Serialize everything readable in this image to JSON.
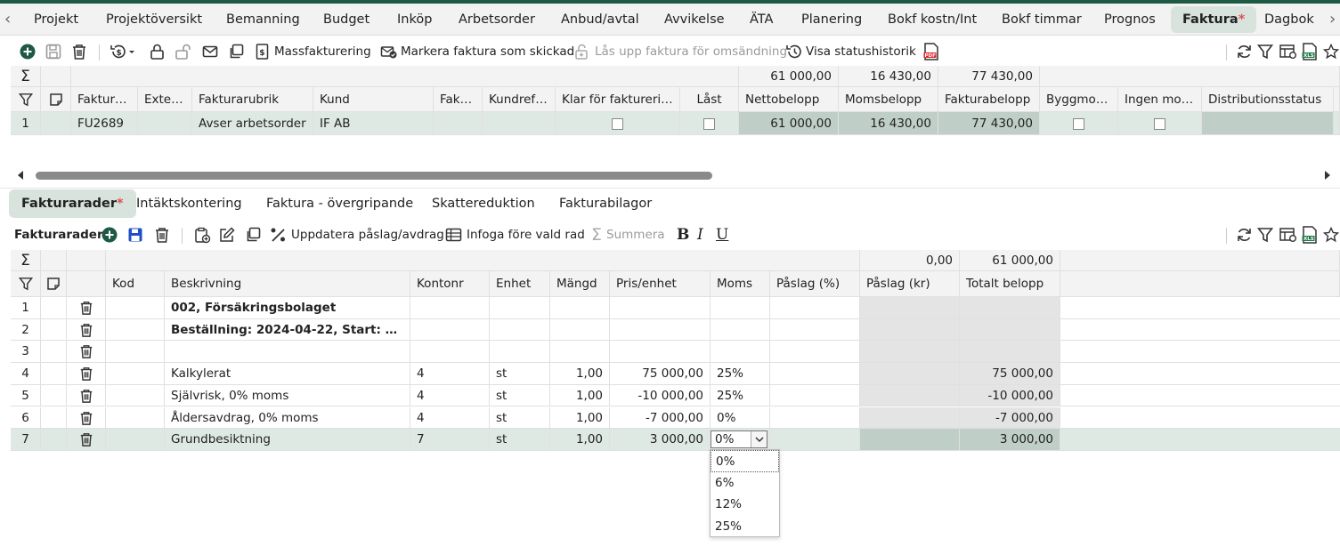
{
  "tabs": [
    "Projekt",
    "Projektöversikt",
    "Bemanning",
    "Budget",
    "Inköp",
    "Arbetsorder",
    "Anbud/avtal",
    "Avvikelse",
    "ÄTA",
    "Planering",
    "Bokf kostn/Int",
    "Bokf timmar",
    "Prognos",
    "Faktura",
    "Dagbok"
  ],
  "active_tab": "Faktura",
  "required_marker": "*",
  "toolbar": {
    "massfakturering": "Massfakturering",
    "markera": "Markera faktura som skickad",
    "las_upp": "Lås upp faktura för omsändning",
    "visa_status": "Visa statushistorik"
  },
  "invoice_grid": {
    "sums": {
      "netto": "61 000,00",
      "moms": "16 430,00",
      "faktura": "77 430,00"
    },
    "headers": [
      "Faktura nr",
      "Extern…",
      "Fakturarubrik",
      "Kund",
      "Fakt…",
      "Kundref nr",
      "Klar för fakturering",
      "Låst",
      "Nettobelopp",
      "Momsbelopp",
      "Fakturabelopp",
      "Byggmoms",
      "Ingen moms",
      "Distributionsstatus"
    ],
    "row": {
      "num": "1",
      "faktura_nr": "FU2689",
      "rubrik": "Avser arbetsorder",
      "kund": "IF AB",
      "netto": "61 000,00",
      "moms": "16 430,00",
      "faktura": "77 430,00"
    }
  },
  "subtabs": [
    "Fakturarader",
    "Intäktskontering",
    "Faktura - övergripande",
    "Skattereduktion",
    "Fakturabilagor"
  ],
  "rows_toolbar": {
    "title": "Fakturarader",
    "uppdatera": "Uppdatera påslag/avdrag",
    "infoga": "Infoga före vald rad",
    "summera": "Summera",
    "bold": "B",
    "italic": "I",
    "underline": "U"
  },
  "rows_grid": {
    "sums": {
      "paslag_kr": "0,00",
      "totalt": "61 000,00"
    },
    "headers": [
      "Kod",
      "Beskrivning",
      "Kontonr",
      "Enhet",
      "Mängd",
      "Pris/enhet",
      "Moms",
      "Påslag (%)",
      "Påslag (kr)",
      "Totalt belopp"
    ],
    "rows": [
      {
        "num": "1",
        "kod": "",
        "beskrivning": "002, Försäkringsbolaget",
        "kontonr": "",
        "enhet": "",
        "mangd": "",
        "pris": "",
        "moms": "",
        "paslag_pct": "",
        "paslag_kr": "",
        "totalt": "",
        "bold": true
      },
      {
        "num": "2",
        "kod": "",
        "beskrivning": "Beställning: 2024-04-22, Start: 2024-…",
        "kontonr": "",
        "enhet": "",
        "mangd": "",
        "pris": "",
        "moms": "",
        "paslag_pct": "",
        "paslag_kr": "",
        "totalt": "",
        "bold": true
      },
      {
        "num": "3",
        "kod": "",
        "beskrivning": "",
        "kontonr": "",
        "enhet": "",
        "mangd": "",
        "pris": "",
        "moms": "",
        "paslag_pct": "",
        "paslag_kr": "",
        "totalt": "",
        "bold": false
      },
      {
        "num": "4",
        "kod": "",
        "beskrivning": "Kalkylerat",
        "kontonr": "4",
        "enhet": "st",
        "mangd": "1,00",
        "pris": "75 000,00",
        "moms": "25%",
        "paslag_pct": "",
        "paslag_kr": "",
        "totalt": "75 000,00",
        "bold": false
      },
      {
        "num": "5",
        "kod": "",
        "beskrivning": "Självrisk, 0% moms",
        "kontonr": "4",
        "enhet": "st",
        "mangd": "1,00",
        "pris": "-10 000,00",
        "moms": "25%",
        "paslag_pct": "",
        "paslag_kr": "",
        "totalt": "-10 000,00",
        "bold": false
      },
      {
        "num": "6",
        "kod": "",
        "beskrivning": "Åldersavdrag, 0% moms",
        "kontonr": "4",
        "enhet": "st",
        "mangd": "1,00",
        "pris": "-7 000,00",
        "moms": "0%",
        "paslag_pct": "",
        "paslag_kr": "",
        "totalt": "-7 000,00",
        "bold": false
      },
      {
        "num": "7",
        "kod": "",
        "beskrivning": "Grundbesiktning",
        "kontonr": "7",
        "enhet": "st",
        "mangd": "1,00",
        "pris": "3 000,00",
        "moms": "0%",
        "paslag_pct": "",
        "paslag_kr": "",
        "totalt": "3 000,00",
        "bold": false
      }
    ]
  },
  "moms_select": {
    "value": "0%",
    "options": [
      "0%",
      "6%",
      "12%",
      "25%"
    ]
  },
  "colors": {
    "brand": "#1e5a43",
    "tab_active": "#d8e3de",
    "selected_row": "#dfe9e4",
    "required": "#e05252"
  }
}
